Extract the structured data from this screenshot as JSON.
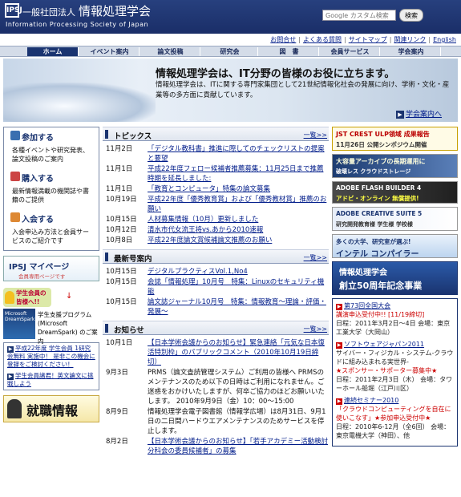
{
  "header": {
    "logo_mark": "IPSJ",
    "org_type": "一般社団法人",
    "org_name": "情報処理学会",
    "org_name_en": "Information Processing Society of Japan",
    "search_placeholder": "Google カスタム検索",
    "search_button": "検索"
  },
  "toplinks": [
    "お問合せ",
    "よくある質問",
    "サイトマップ",
    "関連リンク",
    "English"
  ],
  "nav": [
    "ホーム",
    "イベント案内",
    "論文投稿",
    "研究会",
    "図　書",
    "会員サービス",
    "学会案内"
  ],
  "banner": {
    "title": "情報処理学会は、IT分野の皆様のお役に立ちます。",
    "desc": "情報処理学会は、ITに関する専門家集団として21世紀情報化社会の発展に向け、学術・文化・産業等の多方面に貢献しています。",
    "link": "学会案内へ"
  },
  "left": {
    "sections": [
      {
        "title": "参加する",
        "text": "各種イベントや研究発表、論文投稿のご案内"
      },
      {
        "title": "購入する",
        "text": "最新情報満載の機関誌や書籍のご提供"
      },
      {
        "title": "入会する",
        "text": "入会申込み方法と会員サービスのご紹介です"
      }
    ],
    "ipsj_mypage": "IPSJ マイページ",
    "ipsj_mypage_sub": "会員専用ページです",
    "student_badge": "学生会員の皆様へ!!",
    "dreamspark_text": "学生支援プログラム (Microsoft DreamSpark) のご案内",
    "student_links": [
      "平成22年度 学生会員 1研究会無料 実施中！ 是非この機会に登録をご検討ください！",
      "学生会員諸君！英文論文に挑戦しよう"
    ],
    "job_banner": "就職情報"
  },
  "topics": {
    "heading": "トピックス",
    "more": "一覧>>",
    "items": [
      {
        "date": "11月2日",
        "text": "「デジタル教科書」推進に際してのチェックリストの提案と要望",
        "link": true
      },
      {
        "date": "11月1日",
        "text": "平成22年度フェロー候補者推薦募集：11月25日まで推薦時期を延長しました:",
        "link": true
      },
      {
        "date": "11月1日",
        "text": "「教育とコンピュータ」特集の論文募集",
        "link": true
      },
      {
        "date": "10月19日",
        "text": "平成22年度「優秀教育賞」および「優秀教材賞」推薦のお願い",
        "link": true
      },
      {
        "date": "10月15日",
        "text": "人材募集情報（10月）更新しました",
        "link": true
      },
      {
        "date": "10月12日",
        "text": "清水市代女流王将vs.あから2010速報",
        "link": true
      },
      {
        "date": "10月8日",
        "text": "平成22年度論文賞候補論文推薦のお願い",
        "link": true
      }
    ]
  },
  "latest": {
    "heading": "最新号案内",
    "more": "一覧>>",
    "items": [
      {
        "date": "10月15日",
        "text": "デジタルプラクティスVol.1,No4",
        "link": true
      },
      {
        "date": "10月15日",
        "text": "会誌「情報処理」10月号　特集：Linuxのセキュリティ機能",
        "link": true
      },
      {
        "date": "10月15日",
        "text": "論文誌ジャーナル10月号　特集：情報教育〜理論・評価・発展〜",
        "link": true
      }
    ]
  },
  "notices": {
    "heading": "お知らせ",
    "more": "一覧>>",
    "items": [
      {
        "date": "10月1日",
        "text": "【日本学術会議からのお知らせ】緊急連絡「元気な日本復活特別枠」のパブリックコメント（2010年10月19日締切）",
        "link": true
      },
      {
        "date": "9月3日",
        "text": "PRMS（論文査読管理システム）ご利用の皆様へ PRMSのメンテナンスのため以下の日時はご利用になれません。ご迷惑をおかけいたしますが、何卒ご協力のほどお願いいたします。 2010年9月9日（金）10：00〜15:00",
        "link": false
      },
      {
        "date": "8月9日",
        "text": "情報処理学会電子図書館（情報学広場）は8月31日、9月1日の二日間ハードウエアメンテナンスのためサービスを停止します。",
        "link": false
      },
      {
        "date": "8月2日",
        "text": "【日本学術会議からのお知らせ】「若手アカデミー活動検討分科会の委員候補者」の募集",
        "link": true
      }
    ]
  },
  "right": {
    "ads": [
      {
        "line1": "JST CREST ULP領域 成果報告",
        "line2": "11月26日 公開シンポジウム開催"
      },
      {
        "line1": "大容量アーカイブの長期運用に",
        "line2": "破壊レス クラウドストレージ"
      },
      {
        "line1": "ADOBE FLASH BUILDER 4",
        "line2": "アドビ・オンライン 無償提供!"
      },
      {
        "line1": "ADOBE CREATIVE SUITE 5",
        "line2": "研究開発教育様 学生様 学校様"
      },
      {
        "line1": "多くの大学、研究室が選ぶ!",
        "line2": "インテル コンパイラー"
      }
    ],
    "anniv_line1": "情報処理学会",
    "anniv_line2": "創立50周年記念事業",
    "events": [
      {
        "title": "第73回全国大会",
        "sub": "講演申込受付中!! [11/19締切]",
        "detail": "日程：2011年3月2日〜4日 会場：東京工業大学（大岡山）"
      },
      {
        "title": "ソフトウェアジャパン2011",
        "sub": "",
        "detail": "サイバー・フィジカル・システム-クラウドに組み込まれる実世界-",
        "extra": "★スポンサー・サポーター募集中★",
        "detail2": "日程：2011年2月3日（木） 会場：タワーホール船堀（江戸川区）"
      },
      {
        "title": "連続セミナー2010",
        "sub": "「クラウドコンピューティングを自在に使いこなす」★参加申込受付中★",
        "detail": "日程：2010年6-12月（全6回） 会場：東京電機大学（神田）、他"
      }
    ]
  }
}
